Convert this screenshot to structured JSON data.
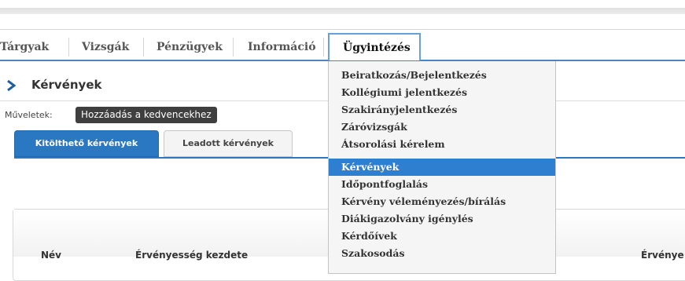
{
  "nav": {
    "items": [
      {
        "label": "Tárgyak"
      },
      {
        "label": "Vizsgák"
      },
      {
        "label": "Pénzügyek"
      },
      {
        "label": "Információ"
      },
      {
        "label": "Ügyintézés"
      }
    ],
    "active_index": 4
  },
  "page": {
    "title": "Kérvények",
    "chevron_icon": "chevron-right-icon"
  },
  "actions": {
    "label": "Műveletek:",
    "favorite_button": "Hozzáadás a kedvencekhez"
  },
  "tabs": [
    {
      "label": "Kitölthető kérvények"
    },
    {
      "label": "Leadott kérvények"
    }
  ],
  "table": {
    "columns": [
      "Név",
      "Érvényesség kezdete",
      "Érvénye"
    ]
  },
  "dropdown": {
    "items": [
      {
        "label": "Beiratkozás/Bejelentkezés"
      },
      {
        "label": "Kollégiumi jelentkezés"
      },
      {
        "label": "Szakirányjelentkezés"
      },
      {
        "label": "Záróvizsgák"
      },
      {
        "label": "Átsorolási kérelem"
      },
      {
        "label": "Kérvények"
      },
      {
        "label": "Időpontfoglalás"
      },
      {
        "label": "Kérvény véleményezés/bírálás"
      },
      {
        "label": "Diákigazolvány igénylés"
      },
      {
        "label": "Kérdőívek"
      },
      {
        "label": "Szakosodás"
      }
    ],
    "selected_index": 5
  },
  "colors": {
    "accent": "#2a78c2",
    "dropdown_selected": "#2f7fd0",
    "favorite_button_bg": "#3f3f3f"
  }
}
